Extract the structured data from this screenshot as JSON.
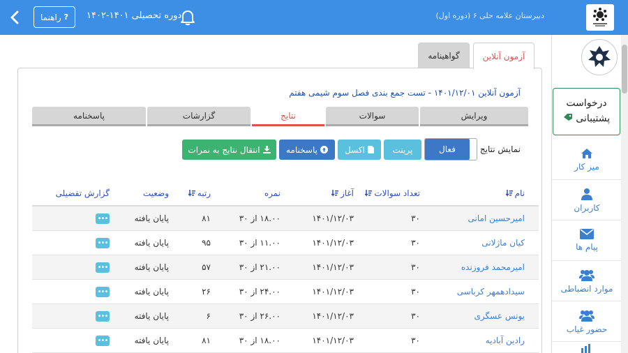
{
  "header": {
    "help_label": "راهنما",
    "period_label": "دوره تحصیلی ۱۴۰۱-۱۴۰۲",
    "school_name": "دبیرستان علامه حلی ۶ (دوره اول)"
  },
  "colors": {
    "header": "#3d8fe6",
    "danger": "#d9534f",
    "success": "#3cb371",
    "info": "#5bc0de",
    "primary": "#3d78c6"
  },
  "sidebar": {
    "support": {
      "line1": "درخواست",
      "line2": "پشتیبانی"
    },
    "items": [
      {
        "label": "میز کار",
        "icon": "home-icon"
      },
      {
        "label": "کاربران",
        "icon": "user-icon"
      },
      {
        "label": "پیام ها",
        "icon": "envelope-icon"
      },
      {
        "label": "موارد انضباطی",
        "icon": "users-icon"
      },
      {
        "label": "حضور غیاب",
        "icon": "users-icon"
      }
    ]
  },
  "main_tabs": {
    "online_exam": "آزمون آنلاین",
    "certificate": "گواهینامه"
  },
  "exam_title": "آزمون آنلاین ۱۴۰۱/۱۲/۰۱ - تست جمع بندی فصل سوم شیمی هفتم",
  "sub_tabs": [
    "ویرایش",
    "سوالات",
    "نتایج",
    "گزارشات",
    "پاسخنامه"
  ],
  "toolbar": {
    "show_results_label": "نمایش نتایج",
    "active_label": "فعال",
    "print_label": "پرینت",
    "excel_label": "اکسل",
    "answer_sheet_label": "پاسخنامه",
    "transfer_label": "انتقال نتایج به نمرات"
  },
  "table": {
    "headers": {
      "name": "نام",
      "count": "تعداد سوالات",
      "start": "آغاز",
      "score": "نمره",
      "rank": "رتبه",
      "status": "وضعیت",
      "detail": "گزارش تفضیلی"
    },
    "rows": [
      {
        "name": "امیرحسین امانی",
        "count": "۳۰",
        "start": "۱۴۰۱/۱۲/۰۳",
        "score": "۱۸.۰۰ از ۳۰",
        "rank": "۸۱",
        "status": "پایان یافته"
      },
      {
        "name": "کیان ماژلانی",
        "count": "۳۰",
        "start": "۱۴۰۱/۱۲/۰۳",
        "score": "۱۱.۰۰ از ۳۰",
        "rank": "۹۵",
        "status": "پایان یافته"
      },
      {
        "name": "امیرمحمد فروزنده",
        "count": "۳۰",
        "start": "۱۴۰۱/۱۲/۰۳",
        "score": "۲۱.۰۰ از ۳۰",
        "rank": "۵۷",
        "status": "پایان یافته"
      },
      {
        "name": "سیدادهمهر کرباسی",
        "count": "۳۰",
        "start": "۱۴۰۱/۱۲/۰۳",
        "score": "۲۴.۰۰ از ۳۰",
        "rank": "۲۶",
        "status": "پایان یافته"
      },
      {
        "name": "یونس عسگری",
        "count": "۳۰",
        "start": "۱۴۰۱/۱۲/۰۳",
        "score": "۲۶.۰۰ از ۳۰",
        "rank": "۶",
        "status": "پایان یافته"
      },
      {
        "name": "رادین آبادیه",
        "count": "۳۰",
        "start": "۱۴۰۱/۱۲/۰۳",
        "score": "۱۸.۰۰ از ۳۰",
        "rank": "۸۱",
        "status": "پایان یافته"
      }
    ]
  }
}
